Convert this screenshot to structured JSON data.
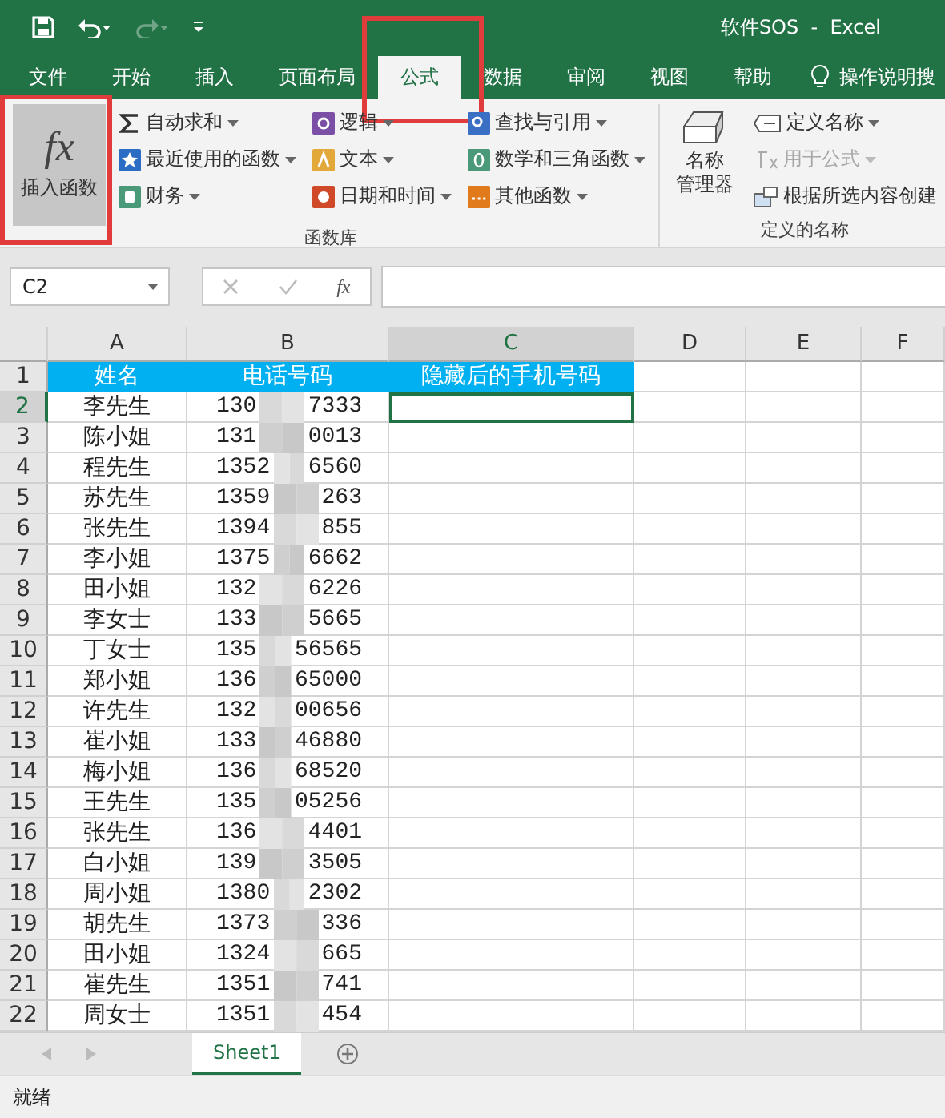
{
  "title_bar": {
    "title": "软件SOS  -  Excel",
    "redo_disabled": true
  },
  "tabs": [
    {
      "label": "文件",
      "selected": false,
      "highlighted": false
    },
    {
      "label": "开始",
      "selected": false,
      "highlighted": false
    },
    {
      "label": "插入",
      "selected": false,
      "highlighted": false
    },
    {
      "label": "页面布局",
      "selected": false,
      "highlighted": false
    },
    {
      "label": "公式",
      "selected": true,
      "highlighted": true
    },
    {
      "label": "数据",
      "selected": false,
      "highlighted": false
    },
    {
      "label": "审阅",
      "selected": false,
      "highlighted": false
    },
    {
      "label": "视图",
      "selected": false,
      "highlighted": false
    },
    {
      "label": "帮助",
      "selected": false,
      "highlighted": false
    }
  ],
  "tell_me": "操作说明搜",
  "ribbon": {
    "insert_function": {
      "symbol": "fx",
      "label": "插入函数",
      "pressed": true,
      "highlighted": true
    },
    "function_library": {
      "label": "函数库",
      "columns": [
        [
          {
            "label": "自动求和",
            "dropdown": true,
            "disabled": false
          },
          {
            "label": "最近使用的函数",
            "dropdown": true,
            "disabled": false
          },
          {
            "label": "财务",
            "dropdown": true,
            "disabled": false
          }
        ],
        [
          {
            "label": "逻辑",
            "dropdown": true,
            "disabled": false
          },
          {
            "label": "文本",
            "dropdown": true,
            "disabled": false
          },
          {
            "label": "日期和时间",
            "dropdown": true,
            "disabled": false
          }
        ],
        [
          {
            "label": "查找与引用",
            "dropdown": true,
            "disabled": false
          },
          {
            "label": "数学和三角函数",
            "dropdown": true,
            "disabled": false
          },
          {
            "label": "其他函数",
            "dropdown": true,
            "disabled": false
          }
        ]
      ]
    },
    "defined_names": {
      "label": "定义的名称",
      "manager": [
        "名称",
        "管理器"
      ],
      "items": [
        {
          "label": "定义名称",
          "dropdown": true,
          "disabled": false
        },
        {
          "label": "用于公式",
          "dropdown": true,
          "disabled": true
        },
        {
          "label": "根据所选内容创建",
          "dropdown": false,
          "disabled": false
        }
      ]
    }
  },
  "formula_bar": {
    "name_box": "C2",
    "fx": "fx"
  },
  "sheet": {
    "columns": [
      {
        "label": "A",
        "selected": false
      },
      {
        "label": "B",
        "selected": false
      },
      {
        "label": "C",
        "selected": true
      },
      {
        "label": "D",
        "selected": false
      },
      {
        "label": "E",
        "selected": false
      },
      {
        "label": "F",
        "selected": false
      }
    ],
    "header": [
      "姓名",
      "电话号码",
      "隐藏后的手机号码"
    ],
    "rows": [
      {
        "number": "2",
        "name": "李先生",
        "phone_start": "130",
        "phone_end": "7333",
        "active_c": true
      },
      {
        "number": "3",
        "name": "陈小姐",
        "phone_start": "131",
        "phone_end": "0013",
        "active_c": false
      },
      {
        "number": "4",
        "name": "程先生",
        "phone_start": "1352",
        "phone_end": "6560",
        "active_c": false
      },
      {
        "number": "5",
        "name": "苏先生",
        "phone_start": "1359",
        "phone_end": "263",
        "active_c": false
      },
      {
        "number": "6",
        "name": "张先生",
        "phone_start": "1394",
        "phone_end": "855",
        "active_c": false
      },
      {
        "number": "7",
        "name": "李小姐",
        "phone_start": "1375",
        "phone_end": "6662",
        "active_c": false
      },
      {
        "number": "8",
        "name": "田小姐",
        "phone_start": "132",
        "phone_end": "6226",
        "active_c": false
      },
      {
        "number": "9",
        "name": "李女士",
        "phone_start": "133",
        "phone_end": "5665",
        "active_c": false
      },
      {
        "number": "10",
        "name": "丁女士",
        "phone_start": "135",
        "phone_end": "56565",
        "active_c": false
      },
      {
        "number": "11",
        "name": "郑小姐",
        "phone_start": "136",
        "phone_end": "65000",
        "active_c": false
      },
      {
        "number": "12",
        "name": "许先生",
        "phone_start": "132",
        "phone_end": "00656",
        "active_c": false
      },
      {
        "number": "13",
        "name": "崔小姐",
        "phone_start": "133",
        "phone_end": "46880",
        "active_c": false
      },
      {
        "number": "14",
        "name": "梅小姐",
        "phone_start": "136",
        "phone_end": "68520",
        "active_c": false
      },
      {
        "number": "15",
        "name": "王先生",
        "phone_start": "135",
        "phone_end": "05256",
        "active_c": false
      },
      {
        "number": "16",
        "name": "张先生",
        "phone_start": "136",
        "phone_end": "4401",
        "active_c": false
      },
      {
        "number": "17",
        "name": "白小姐",
        "phone_start": "139",
        "phone_end": "3505",
        "active_c": false
      },
      {
        "number": "18",
        "name": "周小姐",
        "phone_start": "1380",
        "phone_end": "2302",
        "active_c": false
      },
      {
        "number": "19",
        "name": "胡先生",
        "phone_start": "1373",
        "phone_end": "336",
        "active_c": false
      },
      {
        "number": "20",
        "name": "田小姐",
        "phone_start": "1324",
        "phone_end": "665",
        "active_c": false
      },
      {
        "number": "21",
        "name": "崔先生",
        "phone_start": "1351",
        "phone_end": "741",
        "active_c": false
      },
      {
        "number": "22",
        "name": "周女士",
        "phone_start": "1351",
        "phone_end": "454",
        "active_c": false
      }
    ],
    "header_row_number": "1"
  },
  "sheet_tabs": [
    {
      "label": "Sheet1",
      "selected": true
    }
  ],
  "status": "就绪"
}
